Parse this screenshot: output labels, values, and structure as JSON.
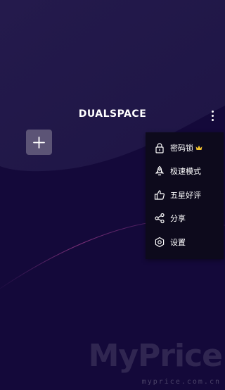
{
  "app": {
    "logo_text": "DUALSPACE"
  },
  "menu": {
    "items": [
      {
        "label": "密码锁",
        "icon": "lock-icon",
        "premium": true
      },
      {
        "label": "极速模式",
        "icon": "rocket-icon",
        "premium": false
      },
      {
        "label": "五星好评",
        "icon": "thumbs-up-icon",
        "premium": false
      },
      {
        "label": "分享",
        "icon": "share-icon",
        "premium": false
      },
      {
        "label": "设置",
        "icon": "settings-icon",
        "premium": false
      }
    ]
  },
  "watermark": {
    "brand": "MyPrice",
    "url": "myprice.com.cn"
  },
  "colors": {
    "background": "#14093a",
    "menu_background": "#0d0a1c",
    "crown": "#f2c230",
    "add_button": "#5c5476"
  }
}
